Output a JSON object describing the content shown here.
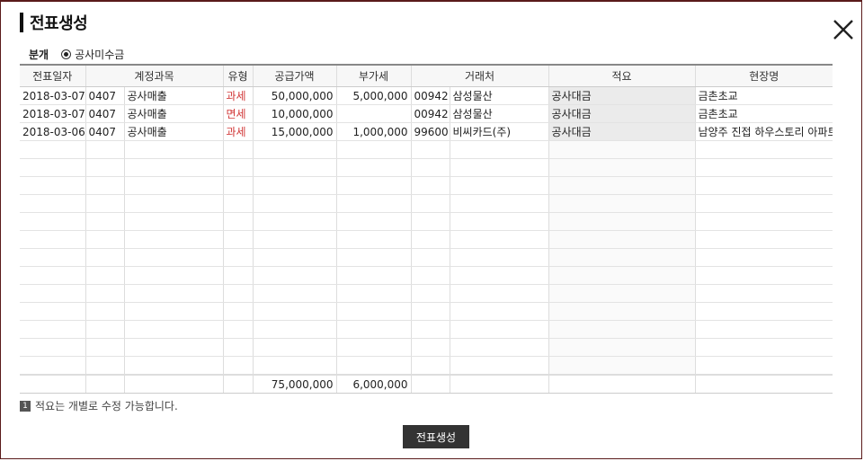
{
  "dialog": {
    "title": "전표생성",
    "close_icon": "close-icon"
  },
  "filter": {
    "label": "분개",
    "option": "공사미수금",
    "selected": true
  },
  "table": {
    "columns": [
      "전표일자",
      "계정과목",
      "유형",
      "공급가액",
      "부가세",
      "거래처",
      "적요",
      "현장명"
    ],
    "rows": [
      {
        "date": "2018-03-07",
        "account_code": "0407",
        "account_name": "공사매출",
        "type": "과세",
        "supply": "50,000,000",
        "vat": "5,000,000",
        "client_code": "00942",
        "client_name": "삼성물산",
        "memo": "공사대금",
        "site": "금촌초교"
      },
      {
        "date": "2018-03-07",
        "account_code": "0407",
        "account_name": "공사매출",
        "type": "면세",
        "supply": "10,000,000",
        "vat": "",
        "client_code": "00942",
        "client_name": "삼성물산",
        "memo": "공사대금",
        "site": "금촌초교"
      },
      {
        "date": "2018-03-06",
        "account_code": "0407",
        "account_name": "공사매출",
        "type": "과세",
        "supply": "15,000,000",
        "vat": "1,000,000",
        "client_code": "99600",
        "client_name": "비씨카드(주)",
        "memo": "공사대금",
        "site": "남양주 진접 하우스토리 아파트"
      }
    ],
    "empty_rows": 13,
    "totals": {
      "supply": "75,000,000",
      "vat": "6,000,000"
    }
  },
  "note": {
    "badge": "1",
    "text": "적요는 개별로 수정 가능합니다."
  },
  "actions": {
    "create_label": "전표생성"
  },
  "colors": {
    "tax_type": "#d23a3a",
    "button_bg": "#333333",
    "memo_bg": "#ebebeb"
  }
}
